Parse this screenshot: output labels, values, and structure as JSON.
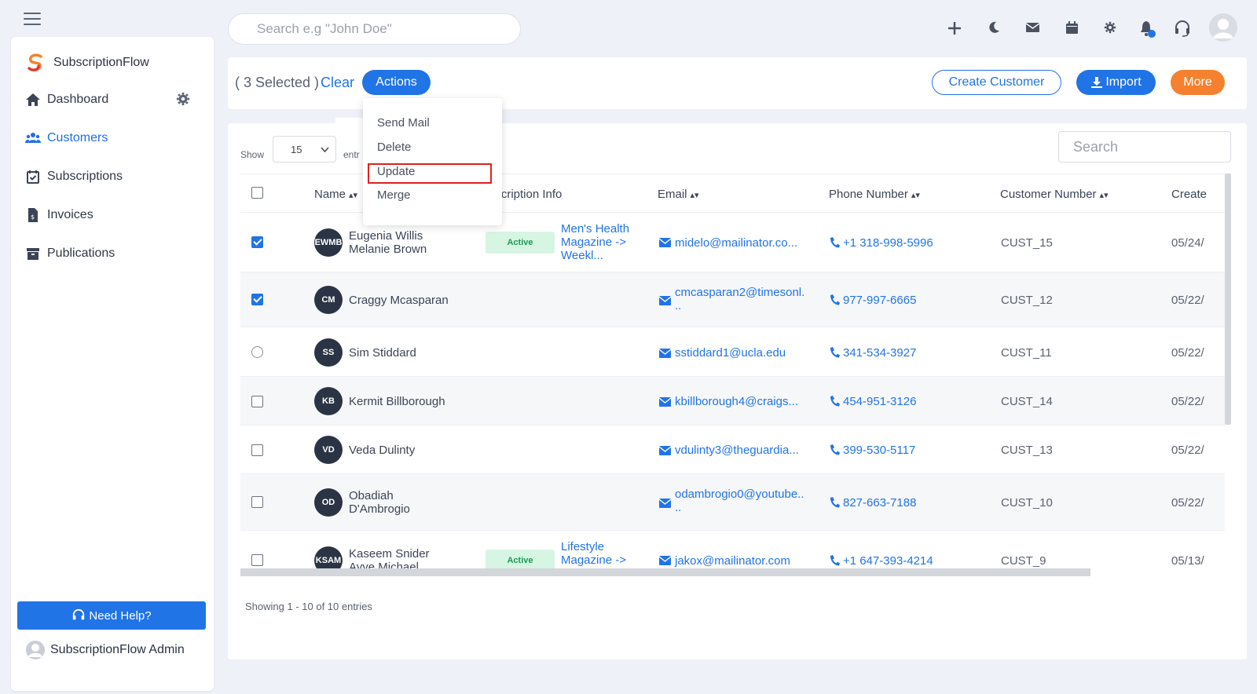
{
  "app": {
    "brand_name": "SubscriptionFlow",
    "brand_color": "#f5812f",
    "accent": "#2174e6"
  },
  "topbar": {
    "search_placeholder": "Search e.g \"John Doe\"",
    "icons": [
      "plus-icon",
      "moon-icon",
      "mail-icon",
      "calendar-icon",
      "gear-icon",
      "bell-icon",
      "headset-icon",
      "user-avatar-icon"
    ]
  },
  "sidebar": {
    "items": [
      {
        "label": "Dashboard",
        "icon": "home-icon"
      },
      {
        "label": "Customers",
        "icon": "users-icon",
        "active": true
      },
      {
        "label": "Subscriptions",
        "icon": "calendar-check-icon"
      },
      {
        "label": "Invoices",
        "icon": "invoice-icon"
      },
      {
        "label": "Publications",
        "icon": "archive-icon"
      }
    ],
    "help_label": "Need Help?",
    "admin_label": "SubscriptionFlow Admin"
  },
  "actionbar": {
    "selected_text": "( 3 Selected )",
    "clear_label": "Clear",
    "actions_label": "Actions",
    "create_label": "Create Customer",
    "import_label": "Import",
    "more_label": "More"
  },
  "actions_menu": {
    "items": [
      "Send Mail",
      "Delete",
      "Update",
      "Merge"
    ],
    "highlighted": "Update"
  },
  "table": {
    "show_label": "Show",
    "page_size": "15",
    "entries_label": "entr",
    "search_placeholder": "Search",
    "columns": [
      "Name",
      "bscription Info",
      "Email",
      "Phone Number",
      "Customer Number",
      "Create"
    ],
    "rows": [
      {
        "checked": true,
        "initials": "EWMB",
        "name1": "Eugenia Willis",
        "name2": "Melanie Brown",
        "status": "Active",
        "sub1": "Men's Health",
        "sub2": "Magazine ->",
        "sub3": "Weekl...",
        "email1": "midelo@mailinator.co...",
        "email2": "",
        "phone": "+1 318-998-5996",
        "customer_number": "CUST_15",
        "created": "05/24/"
      },
      {
        "checked": true,
        "initials": "CM",
        "name1": "Craggy Mcasparan",
        "name2": "",
        "status": "",
        "sub1": "",
        "sub2": "",
        "sub3": "",
        "email1": "cmcasparan2@timesonl.",
        "email2": "..",
        "phone": "977-997-6665",
        "customer_number": "CUST_12",
        "created": "05/22/"
      },
      {
        "checked": false,
        "radio": true,
        "initials": "SS",
        "name1": "Sim Stiddard",
        "name2": "",
        "status": "",
        "sub1": "",
        "sub2": "",
        "sub3": "",
        "email1": "sstiddard1@ucla.edu",
        "email2": "",
        "phone": "341-534-3927",
        "customer_number": "CUST_11",
        "created": "05/22/"
      },
      {
        "checked": false,
        "initials": "KB",
        "name1": "Kermit Billborough",
        "name2": "",
        "status": "",
        "sub1": "",
        "sub2": "",
        "sub3": "",
        "email1": "kbillborough4@craigs...",
        "email2": "",
        "phone": "454-951-3126",
        "customer_number": "CUST_14",
        "created": "05/22/"
      },
      {
        "checked": false,
        "initials": "VD",
        "name1": "Veda Dulinty",
        "name2": "",
        "status": "",
        "sub1": "",
        "sub2": "",
        "sub3": "",
        "email1": "vdulinty3@theguardia...",
        "email2": "",
        "phone": "399-530-5117",
        "customer_number": "CUST_13",
        "created": "05/22/"
      },
      {
        "checked": false,
        "initials": "OD",
        "name1": "Obadiah",
        "name2": "D'Ambrogio",
        "status": "",
        "sub1": "",
        "sub2": "",
        "sub3": "",
        "email1": "odambrogio0@youtube..",
        "email2": "..",
        "phone": "827-663-7188",
        "customer_number": "CUST_10",
        "created": "05/22/"
      },
      {
        "checked": false,
        "initials": "KSAM",
        "name1": "Kaseem Snider",
        "name2": "Ayye Michael",
        "status": "Active",
        "sub1": "Lifestyle",
        "sub2": "Magazine ->",
        "sub3": "",
        "email1": "jakox@mailinator.com",
        "email2": "",
        "phone": "+1 647-393-4214",
        "customer_number": "CUST_9",
        "created": "05/13/"
      }
    ],
    "footer": "Showing 1 - 10 of 10 entries"
  }
}
